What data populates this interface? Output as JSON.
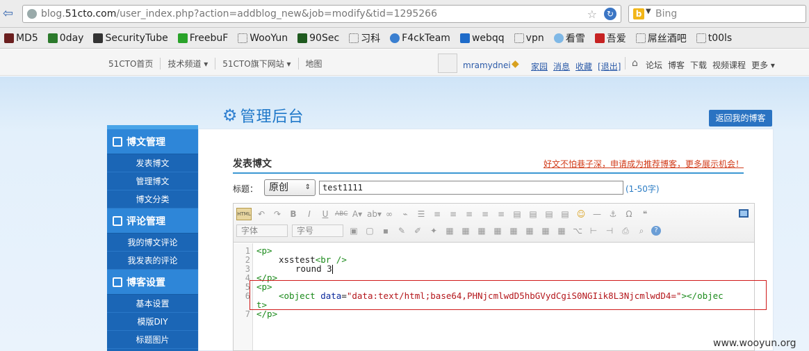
{
  "browser": {
    "url_prefix": "blog.",
    "url_domain": "51cto.com",
    "url_path": "/user_index.php?action=addblog_new&job=modify&tid=1295266",
    "search_placeholder": "Bing",
    "bookmarks": [
      "MD5",
      "0day",
      "SecurityTube",
      "FreebuF",
      "WooYun",
      "90Sec",
      "习科",
      "F4ckTeam",
      "webqq",
      "vpn",
      "看雪",
      "吾爱",
      "屌丝酒吧",
      "t00ls"
    ]
  },
  "sitenav": {
    "items": [
      "51CTO首页",
      "技术频道 ▾",
      "51CTO旗下网站 ▾",
      "地图"
    ],
    "username": "mramydnei",
    "user_links": [
      "家园",
      "消息",
      "收藏",
      "[退出]"
    ],
    "right_links": [
      "论坛",
      "博客",
      "下载",
      "视频课程",
      "更多 ▾"
    ]
  },
  "admin": {
    "title": "管理后台",
    "back_button": "返回我的博客"
  },
  "sidebar": {
    "sections": [
      {
        "title": "博文管理",
        "items": [
          "发表博文",
          "管理博文",
          "博文分类"
        ]
      },
      {
        "title": "评论管理",
        "items": [
          "我的博文评论",
          "我发表的评论"
        ]
      },
      {
        "title": "博客设置",
        "items": [
          "基本设置",
          "模版DIY",
          "标题图片"
        ]
      }
    ]
  },
  "post": {
    "section_title": "发表博文",
    "promo_link": "好文不怕巷子深，申请成为推荐博客，更多展示机会！",
    "title_label": "标题：",
    "type_value": "原创",
    "title_value": "test1111",
    "char_hint": "(1-50字)"
  },
  "editor": {
    "font_select": "字体",
    "size_select": "字号",
    "line_numbers": [
      "1",
      "2",
      "3",
      "4",
      "5",
      "6",
      "",
      "7"
    ],
    "code": {
      "l1": "<p>",
      "l2_text": "xsstest",
      "l2_tag": "<br />",
      "l3": "round 3",
      "l4": "</p>",
      "l5": "<p>",
      "l6_open": "<object",
      "l6_attr": "data",
      "l6_eq": "=",
      "l6_str": "\"data:text/html;base64,PHNjcmlwdD5hbGVydCgiS0NGIik8L3NjcmlwdD4=\"",
      "l6_close": "></objec",
      "l6b": "t>",
      "l7": "</p>"
    }
  },
  "watermark": "www.wooyun.org"
}
